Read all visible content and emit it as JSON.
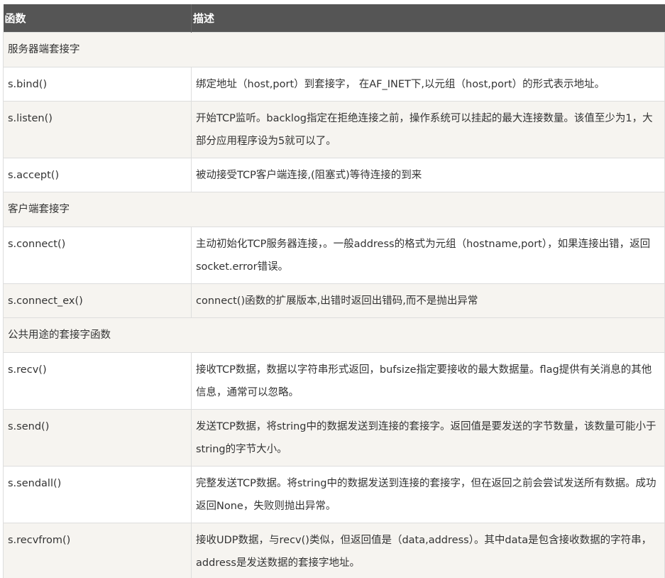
{
  "table": {
    "headers": [
      "函数",
      "描述"
    ],
    "rows": [
      {
        "type": "section",
        "label": "服务器端套接字"
      },
      {
        "type": "row",
        "func": "s.bind()",
        "desc": "绑定地址（host,port）到套接字， 在AF_INET下,以元组（host,port）的形式表示地址。"
      },
      {
        "type": "row",
        "func": "s.listen()",
        "desc": "开始TCP监听。backlog指定在拒绝连接之前，操作系统可以挂起的最大连接数量。该值至少为1，大部分应用程序设为5就可以了。"
      },
      {
        "type": "row",
        "func": "s.accept()",
        "desc": "被动接受TCP客户端连接,(阻塞式)等待连接的到来"
      },
      {
        "type": "section",
        "label": "客户端套接字"
      },
      {
        "type": "row",
        "func": "s.connect()",
        "desc": "主动初始化TCP服务器连接，。一般address的格式为元组（hostname,port），如果连接出错，返回socket.error错误。"
      },
      {
        "type": "row",
        "func": "s.connect_ex()",
        "desc": "connect()函数的扩展版本,出错时返回出错码,而不是抛出异常"
      },
      {
        "type": "section",
        "label": "公共用途的套接字函数"
      },
      {
        "type": "row",
        "func": "s.recv()",
        "desc": "接收TCP数据，数据以字符串形式返回，bufsize指定要接收的最大数据量。flag提供有关消息的其他信息，通常可以忽略。"
      },
      {
        "type": "row",
        "func": "s.send()",
        "desc": "发送TCP数据，将string中的数据发送到连接的套接字。返回值是要发送的字节数量，该数量可能小于string的字节大小。"
      },
      {
        "type": "row",
        "func": "s.sendall()",
        "desc": "完整发送TCP数据。将string中的数据发送到连接的套接字，但在返回之前会尝试发送所有数据。成功返回None，失败则抛出异常。"
      },
      {
        "type": "row",
        "func": "s.recvfrom()",
        "desc": "接收UDP数据，与recv()类似，但返回值是（data,address）。其中data是包含接收数据的字符串，address是发送数据的套接字地址。"
      }
    ]
  }
}
